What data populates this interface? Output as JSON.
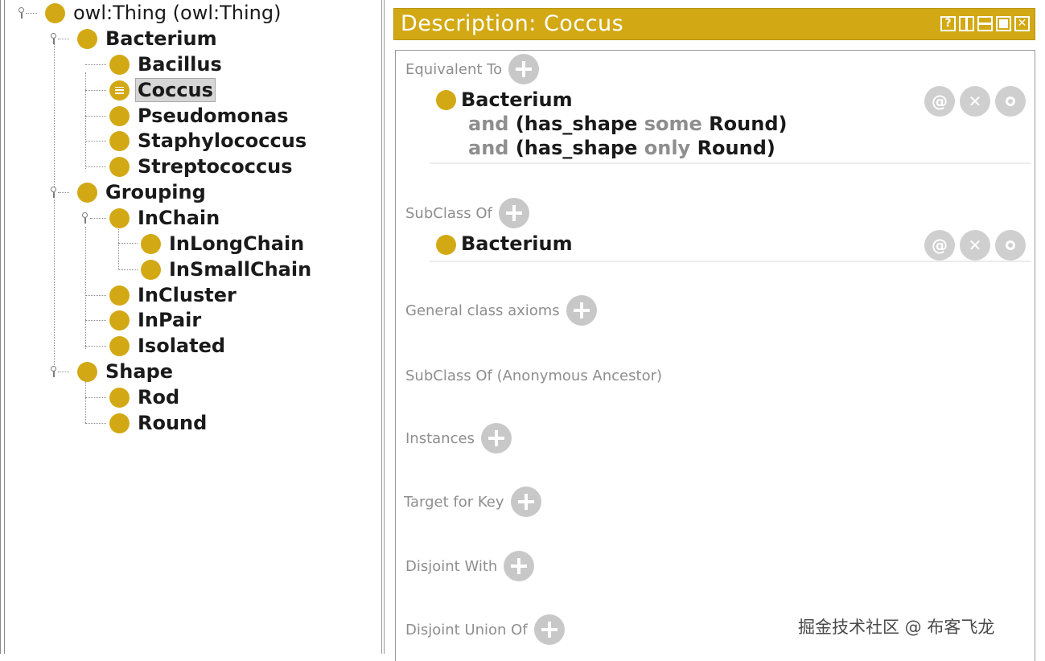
{
  "tree": {
    "root": "owl:Thing (owl:Thing)",
    "bacterium": "Bacterium",
    "bacillus": "Bacillus",
    "coccus": "Coccus",
    "pseudomonas": "Pseudomonas",
    "staphylococcus": "Staphylococcus",
    "streptococcus": "Streptococcus",
    "grouping": "Grouping",
    "inchain": "InChain",
    "inlongchain": "InLongChain",
    "insmallchain": "InSmallChain",
    "incluster": "InCluster",
    "inpair": "InPair",
    "isolated": "Isolated",
    "shape": "Shape",
    "rod": "Rod",
    "round": "Round",
    "selected": "Coccus"
  },
  "panel": {
    "title": "Description: Coccus",
    "buttons": {
      "help": "?",
      "close": "✕"
    }
  },
  "equivalent": {
    "label": "Equivalent To",
    "cls": "Bacterium",
    "line2": {
      "and": "and",
      "prop": "(has_shape",
      "q": "some",
      "filler": "Round)"
    },
    "line3": {
      "and": "and",
      "prop": "(has_shape",
      "q": "only",
      "filler": "Round)"
    }
  },
  "subclass": {
    "label": "SubClass Of",
    "cls": "Bacterium"
  },
  "sections": {
    "general": "General class axioms",
    "anon": "SubClass Of (Anonymous Ancestor)",
    "instances": "Instances",
    "target": "Target for Key",
    "disjoint": "Disjoint With",
    "union": "Disjoint Union Of"
  },
  "actions": {
    "annotate": "@",
    "delete": "✕"
  },
  "watermark": "掘金技术社区 @ 布客飞龙",
  "colors": {
    "class_dot": "#d2a914",
    "header_bg": "#d2a914"
  }
}
